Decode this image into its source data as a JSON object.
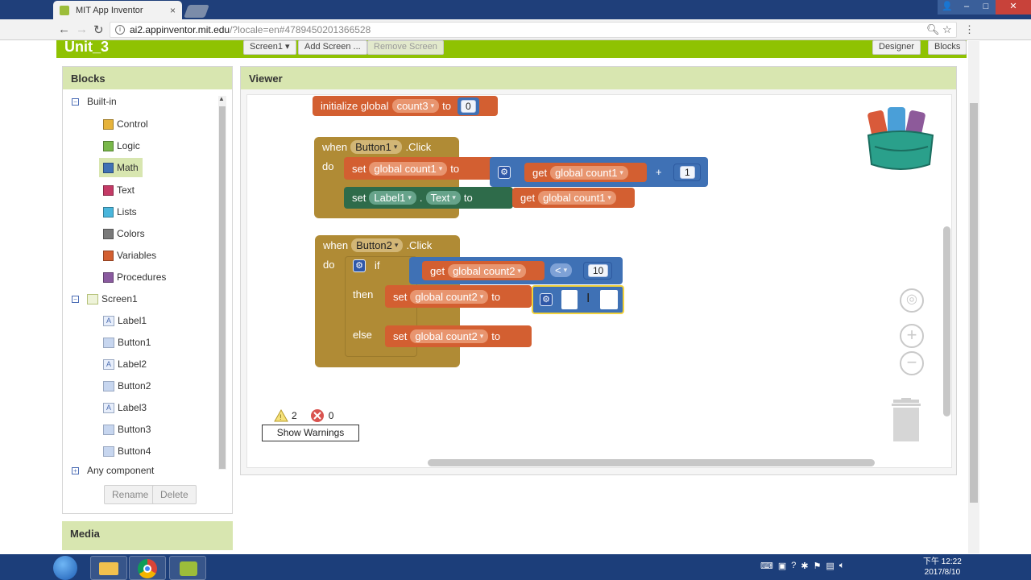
{
  "browser": {
    "tab_title": "MIT App Inventor",
    "tab_close": "×",
    "url_host": "ai2.appinventor.mit.edu",
    "url_rest": "/?locale=en#4789450201366528"
  },
  "header": {
    "project_title": "Unit_3",
    "screen_select": "Screen1 ▾",
    "add_screen": "Add Screen ...",
    "remove_screen": "Remove Screen",
    "designer": "Designer",
    "blocks": "Blocks"
  },
  "blocks_panel": {
    "title": "Blocks",
    "builtin": "Built-in",
    "builtin_items": [
      {
        "label": "Control",
        "color": "#e6b33b"
      },
      {
        "label": "Logic",
        "color": "#79b84a"
      },
      {
        "label": "Math",
        "color": "#3f71b5"
      },
      {
        "label": "Text",
        "color": "#c43a66"
      },
      {
        "label": "Lists",
        "color": "#4ab6dc"
      },
      {
        "label": "Colors",
        "color": "#7a7a7a"
      },
      {
        "label": "Variables",
        "color": "#d35f31"
      },
      {
        "label": "Procedures",
        "color": "#8a5a9f"
      }
    ],
    "screen": "Screen1",
    "components": [
      "Label1",
      "Button1",
      "Label2",
      "Button2",
      "Label3",
      "Button3",
      "Button4"
    ],
    "any_component": "Any component",
    "rename": "Rename",
    "delete": "Delete"
  },
  "media": {
    "title": "Media"
  },
  "viewer": {
    "title": "Viewer"
  },
  "workspace": {
    "init": {
      "text": "initialize global",
      "var": "count3",
      "to": "to",
      "value": "0"
    },
    "event1": {
      "when": "when",
      "component": "Button1",
      "event": ".Click",
      "do": "do",
      "set1": {
        "set": "set",
        "var": "global count1",
        "to": "to",
        "get": "get",
        "get_var": "global count1",
        "op": "+",
        "num": "1"
      },
      "set2": {
        "set": "set",
        "component": "Label1",
        "dot": ".",
        "prop": "Text",
        "to": "to",
        "get": "get",
        "get_var": "global count1"
      }
    },
    "event2": {
      "when": "when",
      "component": "Button2",
      "event": ".Click",
      "do": "do",
      "if": "if",
      "then": "then",
      "else": "else",
      "cond": {
        "get": "get",
        "var": "global count2",
        "op": "<",
        "num": "10"
      },
      "then_set": {
        "set": "set",
        "var": "global count2",
        "to": "to"
      },
      "else_set": {
        "set": "set",
        "var": "global count2",
        "to": "to"
      }
    },
    "warnings_count": "2",
    "errors_count": "0",
    "show_warnings": "Show Warnings"
  },
  "taskbar": {
    "time": "下午 12:22",
    "date": "2017/8/10"
  }
}
